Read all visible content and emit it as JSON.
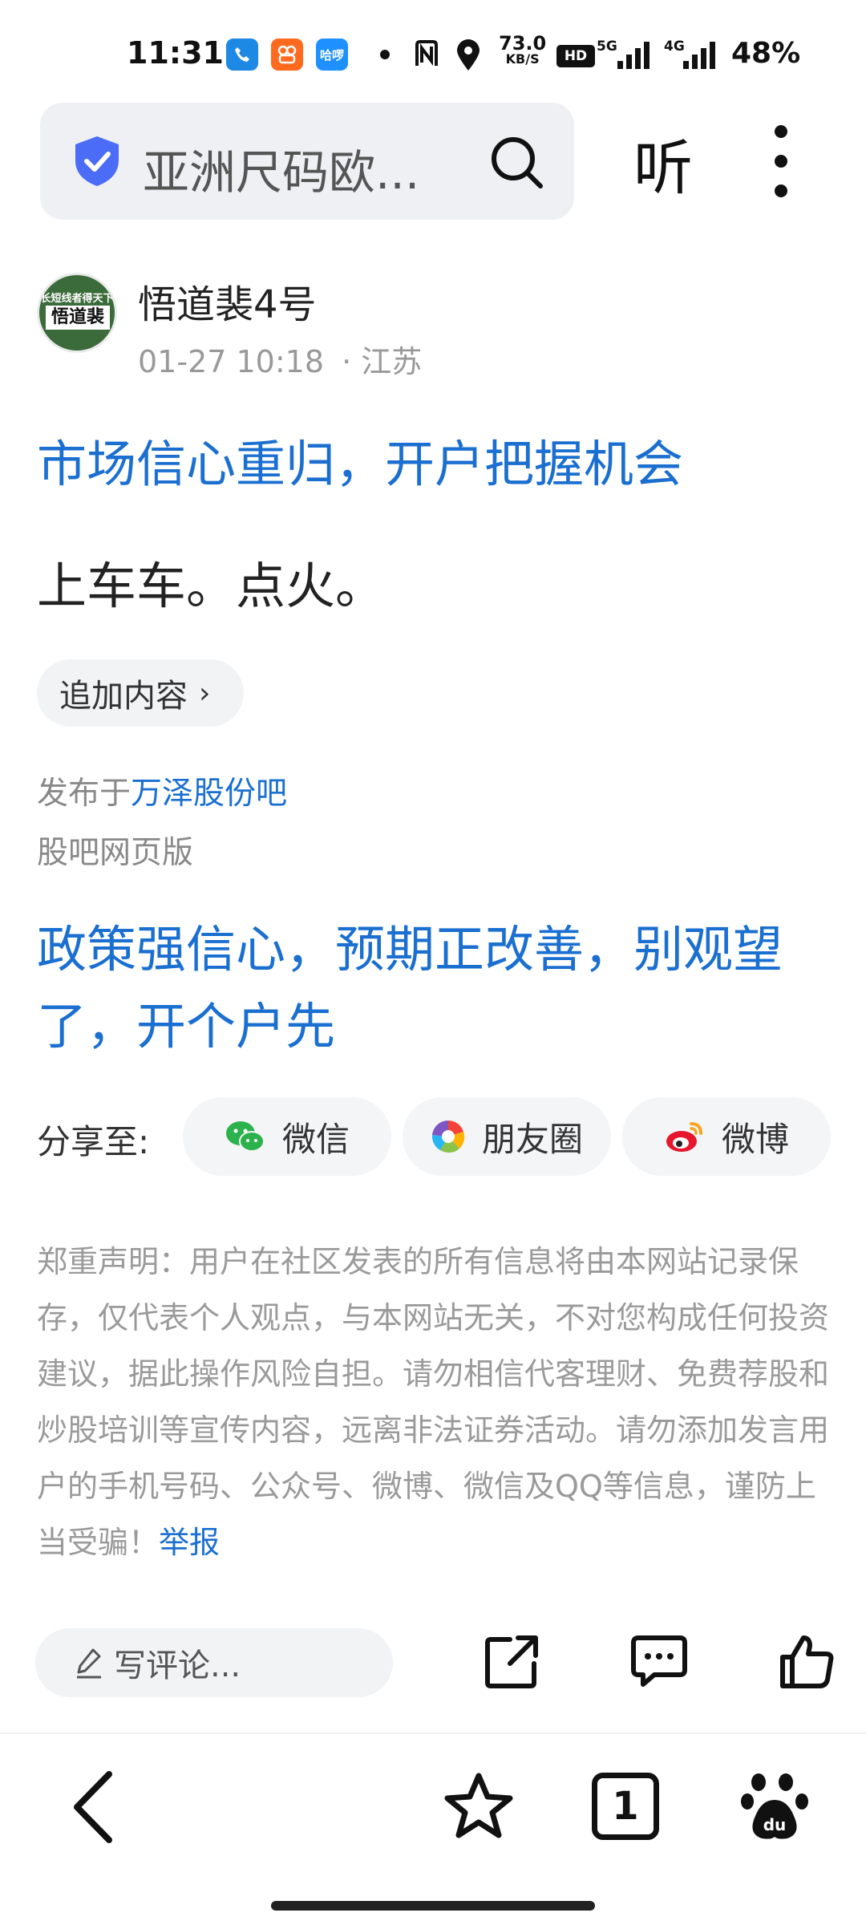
{
  "status_bar": {
    "time": "11:31",
    "app_icons": [
      "phone-app-icon",
      "kuaishou-app-icon",
      "haluo-app-icon"
    ],
    "haluo_label": "哈啰",
    "net_speed_value": "73.0",
    "net_speed_unit": "KB/S",
    "hd_label": "HD",
    "signal1_label": "5G",
    "signal2_label": "4G",
    "battery": "48%"
  },
  "header": {
    "search_text": "亚洲尺码欧...",
    "listen_label": "听"
  },
  "author": {
    "avatar_top_text": "长短线者得天下",
    "avatar_main_text": "悟道裴",
    "name": "悟道裴4号",
    "datetime": "01-27 10:18",
    "location": "· 江苏"
  },
  "post": {
    "title": "市场信心重归，开户把握机会",
    "body": "上车车。点火。",
    "append_label": "追加内容",
    "published_prefix": "发布于",
    "forum_name": "万泽股份吧",
    "web_version": "股吧网页版",
    "promo_text": "政策强信心，预期正改善，别观望了，开个户先"
  },
  "share": {
    "label": "分享至:",
    "wechat": "微信",
    "moments": "朋友圈",
    "weibo": "微博"
  },
  "disclaimer": {
    "text": "郑重声明：用户在社区发表的所有信息将由本网站记录保存，仅代表个人观点，与本网站无关，不对您构成任何投资建议，据此操作风险自担。请勿相信代客理财、免费荐股和炒股培训等宣传内容，远离非法证券活动。请勿添加发言用户的手机号码、公众号、微博、微信及QQ等信息，谨防上当受骗！",
    "report_label": "举报"
  },
  "comment_bar": {
    "placeholder": "写评论..."
  },
  "bottom_nav": {
    "tab_count": "1"
  },
  "colors": {
    "accent_blue": "#1a6fd0",
    "muted_gray": "#9a9a9a",
    "pill_bg": "#f2f3f5"
  }
}
